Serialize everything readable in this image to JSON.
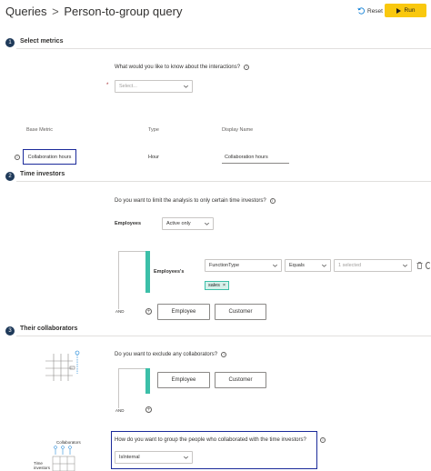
{
  "header": {
    "breadcrumb_root": "Queries",
    "breadcrumb_sep": ">",
    "title": "Person-to-group query",
    "reset_label": "Reset",
    "run_label": "Run"
  },
  "section1": {
    "number": "1",
    "title": "Select metrics",
    "question": "What would you like to know about the interactions?",
    "required_mark": "*",
    "select_placeholder": "Select...",
    "columns": {
      "base_metric": "Base Metric",
      "type": "Type",
      "display_name": "Display Name"
    },
    "row": {
      "base_metric": "Collaboration hours",
      "type": "Hour",
      "display_name": "Collaboration hours"
    }
  },
  "section2": {
    "number": "2",
    "title": "Time investors",
    "question": "Do you want to limit the analysis to only certain time investors?",
    "employees_label": "Employees",
    "employees_value": "Active only",
    "group_label": "Employees's",
    "attribute_value": "FunctionType",
    "operator_value": "Equals",
    "values_value": "1 selected",
    "chip_label": "sales",
    "and_label": "AND",
    "employee_button": "Employee",
    "customer_button": "Customer"
  },
  "section3": {
    "number": "3",
    "title": "Their collaborators",
    "exclude_question": "Do you want to exclude any collaborators?",
    "employee_button": "Employee",
    "customer_button": "Customer",
    "and_label": "AND",
    "group_question": "How do you want to group the people who collaborated with the time investors?",
    "group_value": "IsInternal",
    "illus_collaborators": "Collaborators",
    "illus_time_investors": "Time\ninvestors"
  },
  "colors": {
    "accent_yellow": "#f9c80e",
    "section_badge": "#1f3a5a",
    "teal": "#3cbfa8",
    "highlight": "#1b2a9a"
  },
  "icons": [
    "chevron-right-icon",
    "reset-icon",
    "play-icon",
    "info-icon",
    "chevron-down-icon",
    "plus-circle-icon",
    "trash-icon",
    "close-icon"
  ]
}
